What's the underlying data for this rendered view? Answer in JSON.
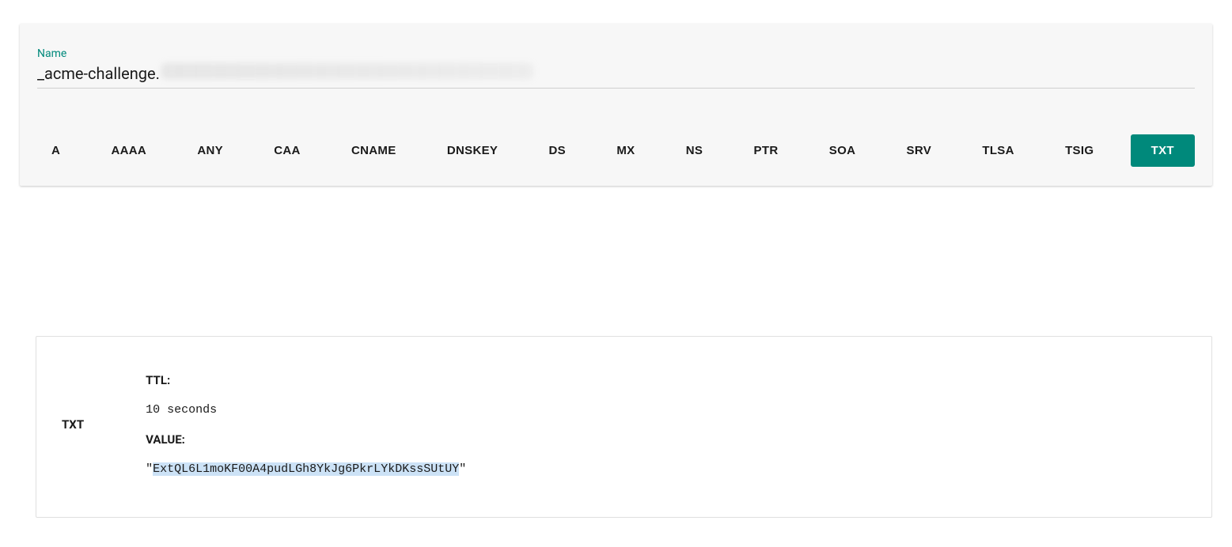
{
  "query": {
    "name_label": "Name",
    "name_value": "_acme-challenge.",
    "record_types": [
      "A",
      "AAAA",
      "ANY",
      "CAA",
      "CNAME",
      "DNSKEY",
      "DS",
      "MX",
      "NS",
      "PTR",
      "SOA",
      "SRV",
      "TLSA",
      "TSIG",
      "TXT"
    ],
    "active_type": "TXT"
  },
  "result": {
    "type": "TXT",
    "ttl_label": "TTL:",
    "ttl_value": "10 seconds",
    "value_label": "VALUE:",
    "value_quote_open": "\"",
    "value_text": "ExtQL6L1moKF00A4pudLGh8YkJg6PkrLYkDKssSUtUY",
    "value_quote_close": "\""
  }
}
